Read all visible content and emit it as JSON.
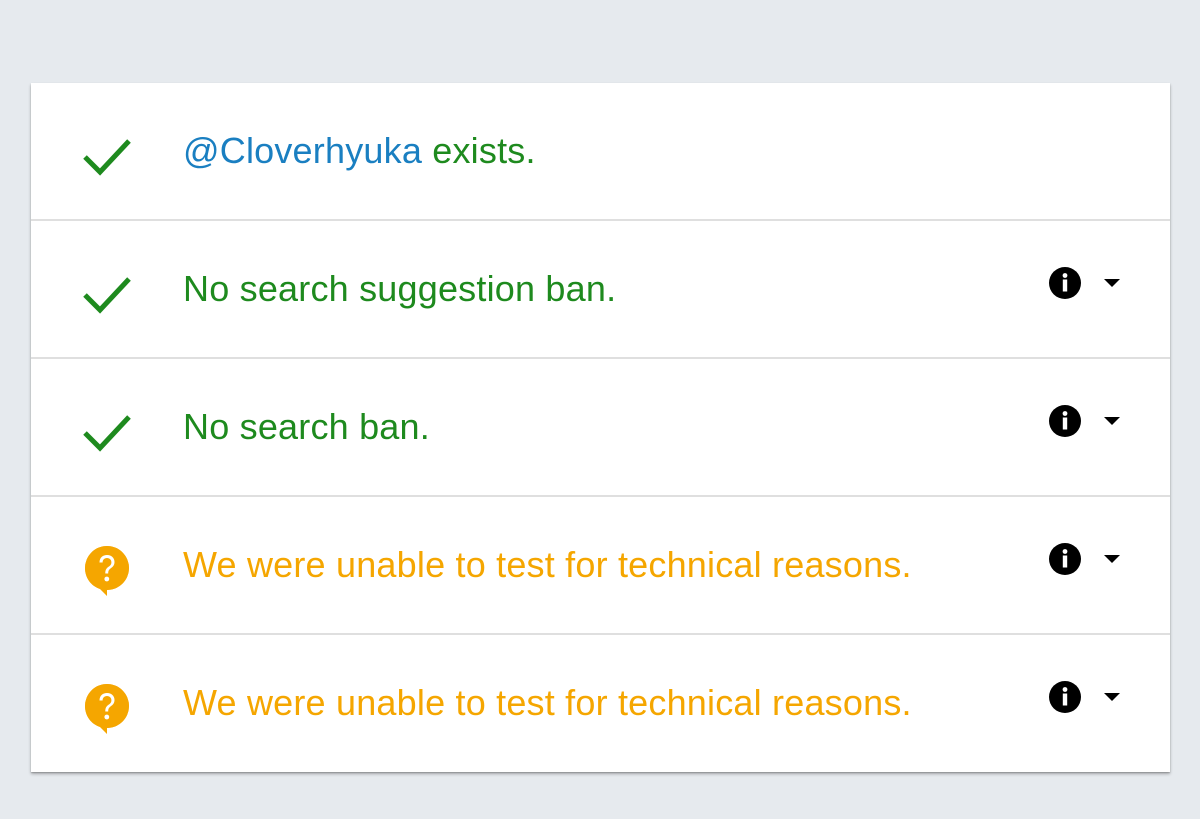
{
  "colors": {
    "page_bg": "#e6eaee",
    "card_bg": "#ffffff",
    "ok_green": "#1e8a1e",
    "link_blue": "#1a7fc1",
    "warn_orange": "#f5a600",
    "icon_black": "#000000"
  },
  "results": [
    {
      "status": "ok",
      "icon": "checkmark-icon",
      "handle": "@Cloverhyuka",
      "text": " exists.",
      "has_actions": false
    },
    {
      "status": "ok",
      "icon": "checkmark-icon",
      "text": "No search suggestion ban.",
      "has_actions": true
    },
    {
      "status": "ok",
      "icon": "checkmark-icon",
      "text": "No search ban.",
      "has_actions": true
    },
    {
      "status": "unknown",
      "icon": "question-bubble-icon",
      "text": "We were unable to test for technical reasons.",
      "has_actions": true
    },
    {
      "status": "unknown",
      "icon": "question-bubble-icon",
      "text": "We were unable to test for technical reasons.",
      "has_actions": true
    }
  ]
}
